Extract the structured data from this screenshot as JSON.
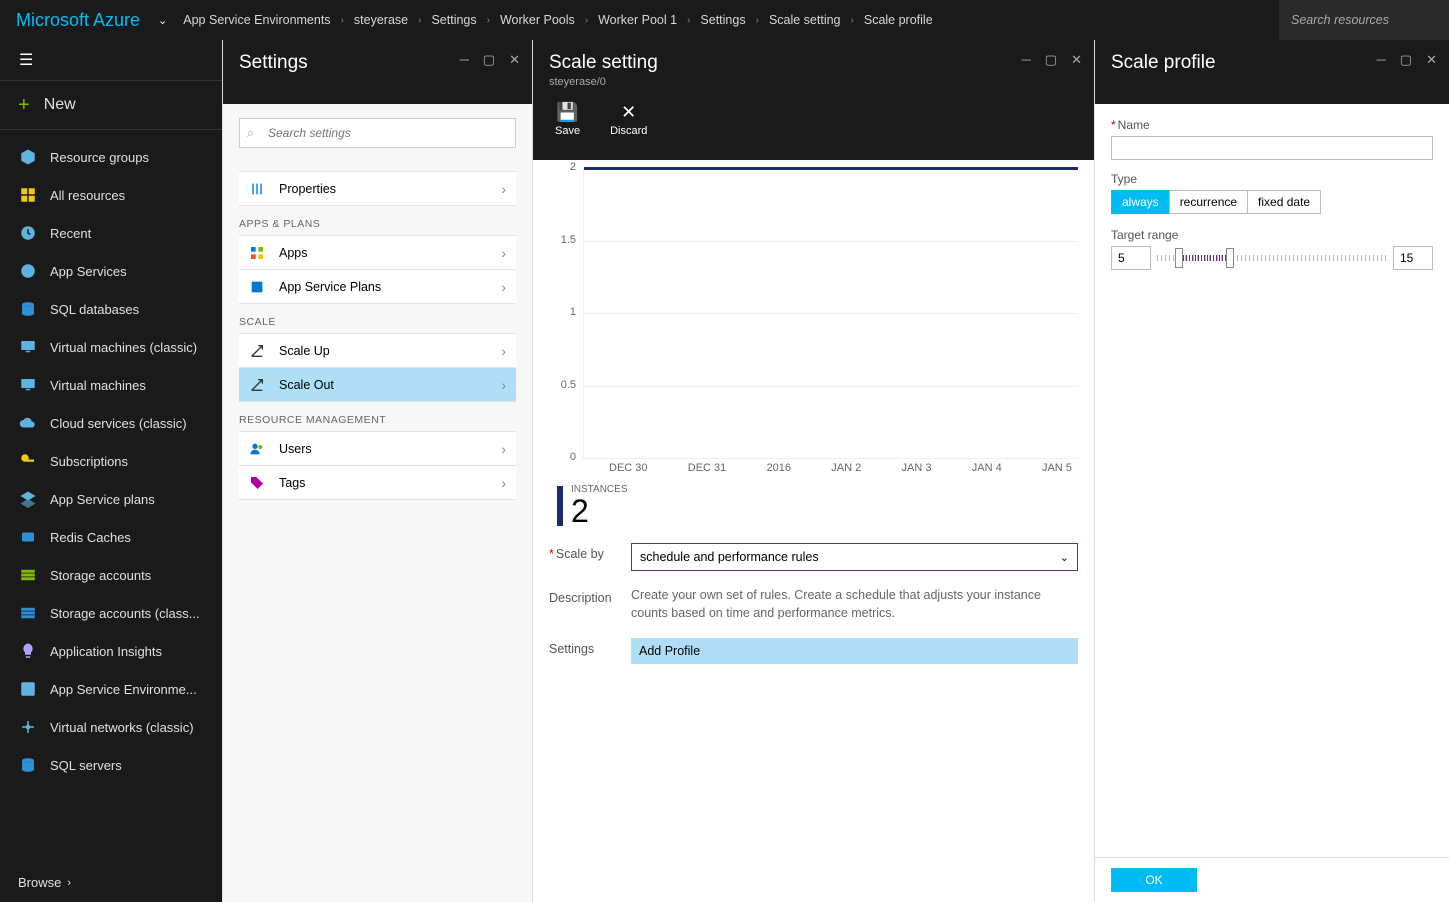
{
  "brand": "Microsoft Azure",
  "search_placeholder": "Search resources",
  "breadcrumbs": [
    "App Service Environments",
    "steyerase",
    "Settings",
    "Worker Pools",
    "Worker Pool 1",
    "Settings",
    "Scale setting",
    "Scale profile"
  ],
  "leftnav": {
    "new": "New",
    "browse": "Browse",
    "items": [
      {
        "icon": "cube",
        "label": "Resource groups",
        "color": "#5fb3e0"
      },
      {
        "icon": "grid",
        "label": "All resources",
        "color": "#f2c811"
      },
      {
        "icon": "clock",
        "label": "Recent",
        "color": "#5fb3e0"
      },
      {
        "icon": "globe",
        "label": "App Services",
        "color": "#5fb3e0"
      },
      {
        "icon": "db",
        "label": "SQL databases",
        "color": "#2d8fd6"
      },
      {
        "icon": "monitor",
        "label": "Virtual machines (classic)",
        "color": "#5fb3e0"
      },
      {
        "icon": "monitor",
        "label": "Virtual machines",
        "color": "#5fb3e0"
      },
      {
        "icon": "cloud",
        "label": "Cloud services (classic)",
        "color": "#5fb3e0"
      },
      {
        "icon": "key",
        "label": "Subscriptions",
        "color": "#f2c811"
      },
      {
        "icon": "layers",
        "label": "App Service plans",
        "color": "#5fb3e0"
      },
      {
        "icon": "cache",
        "label": "Redis Caches",
        "color": "#2d8fd6"
      },
      {
        "icon": "storage",
        "label": "Storage accounts",
        "color": "#7fba00"
      },
      {
        "icon": "storage",
        "label": "Storage accounts (class...",
        "color": "#2d8fd6"
      },
      {
        "icon": "bulb",
        "label": "Application Insights",
        "color": "#b4a0ff"
      },
      {
        "icon": "appenv",
        "label": "App Service Environme...",
        "color": "#5fb3e0"
      },
      {
        "icon": "network",
        "label": "Virtual networks (classic)",
        "color": "#5fb3e0"
      },
      {
        "icon": "db",
        "label": "SQL servers",
        "color": "#2d8fd6"
      }
    ]
  },
  "settings_blade": {
    "title": "Settings",
    "search_placeholder": "Search settings",
    "items_general": [
      {
        "label": "Properties",
        "icon": "props"
      }
    ],
    "sect_apps": "APPS & PLANS",
    "items_apps": [
      {
        "label": "Apps",
        "icon": "apps"
      },
      {
        "label": "App Service Plans",
        "icon": "plans"
      }
    ],
    "sect_scale": "SCALE",
    "items_scale": [
      {
        "label": "Scale Up",
        "icon": "scaleup",
        "selected": false
      },
      {
        "label": "Scale Out",
        "icon": "scaleout",
        "selected": true
      }
    ],
    "sect_res": "RESOURCE MANAGEMENT",
    "items_res": [
      {
        "label": "Users",
        "icon": "users"
      },
      {
        "label": "Tags",
        "icon": "tags"
      }
    ]
  },
  "scale_blade": {
    "title": "Scale setting",
    "subtitle": "steyerase/0",
    "toolbar": {
      "save": "Save",
      "discard": "Discard"
    },
    "instances_label": "INSTANCES",
    "instances_value": "2",
    "scale_by_label": "Scale by",
    "scale_by_value": "schedule and performance rules",
    "desc_label": "Description",
    "desc_value": "Create your own set of rules. Create a schedule that adjusts your instance counts based on time and performance metrics.",
    "settings_label": "Settings",
    "add_profile": "Add Profile"
  },
  "profile_blade": {
    "title": "Scale profile",
    "name_label": "Name",
    "name_value": "",
    "type_label": "Type",
    "type_options": [
      "always",
      "recurrence",
      "fixed date"
    ],
    "type_selected": "always",
    "range_label": "Target range",
    "range_min": "5",
    "range_max": "15",
    "ok": "OK"
  },
  "chart_data": {
    "type": "line",
    "title": "",
    "xlabel": "",
    "ylabel": "",
    "ylim": [
      0,
      2
    ],
    "yticks": [
      0,
      0.5,
      1,
      1.5,
      2
    ],
    "categories": [
      "DEC 30",
      "DEC 31",
      "2016",
      "JAN 2",
      "JAN 3",
      "JAN 4",
      "JAN 5"
    ],
    "series": [
      {
        "name": "Instances",
        "values": [
          2,
          2,
          2,
          2,
          2,
          2,
          2
        ],
        "color": "#1b2a6b"
      }
    ]
  }
}
